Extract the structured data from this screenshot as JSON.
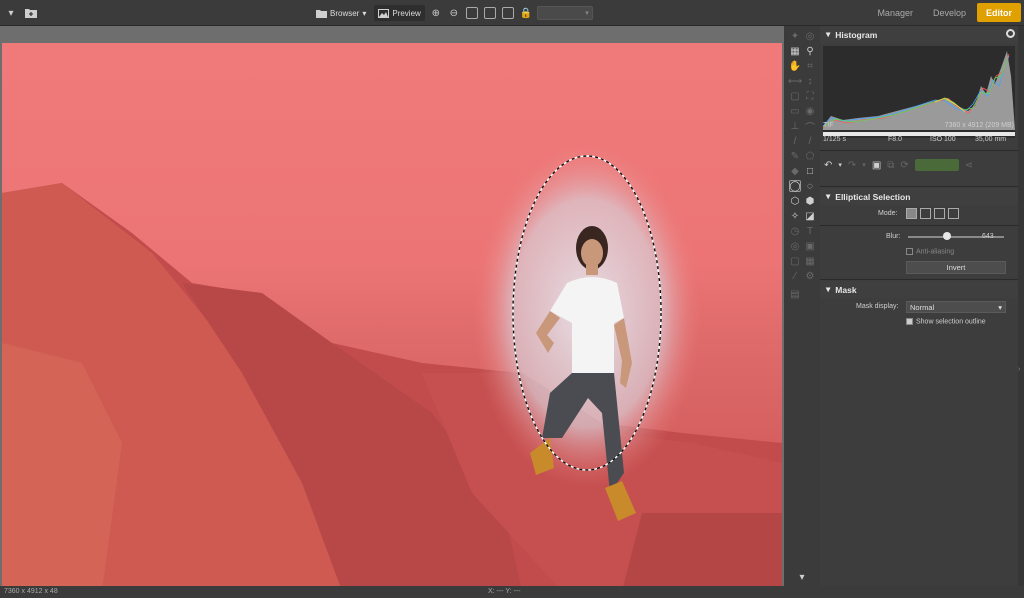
{
  "topbar": {
    "menu_icon": "chevron-down-icon",
    "folder_icon": "folder-add-icon",
    "browser_label": "Browser",
    "preview_label": "Preview",
    "modes": [
      "Manager",
      "Develop",
      "Editor"
    ],
    "active_mode": "Editor",
    "accent_color": "#e0a000"
  },
  "histogram": {
    "title": "Histogram",
    "file_type": "TIF",
    "dimensions": "7360 x 4912 (209 MB)",
    "shutter": "1/125 s",
    "aperture": "F8.0",
    "iso": "ISO 100",
    "focal": "35,00 mm"
  },
  "elliptical_selection": {
    "title": "Elliptical Selection",
    "mode_label": "Mode:",
    "blur_label": "Blur:",
    "blur_value": "643",
    "anti_aliasing_label": "Anti-aliasing",
    "invert_label": "Invert"
  },
  "mask": {
    "title": "Mask",
    "display_label": "Mask display:",
    "display_value": "Normal",
    "show_outline_label": "Show selection outline"
  },
  "status": {
    "left": "7360 x 4912 x 48",
    "coords": "X: ---   Y: ---"
  },
  "colors": {
    "mask_overlay": "#f07a7a",
    "panel_bg": "#3d3d3d"
  }
}
